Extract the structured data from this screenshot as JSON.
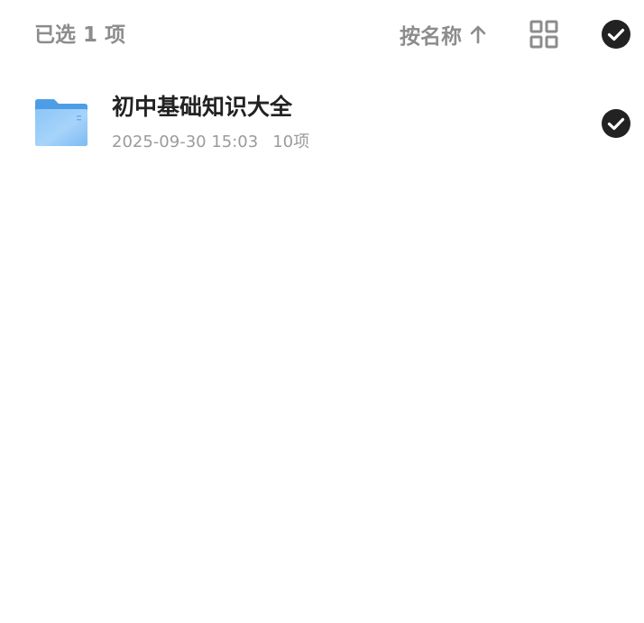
{
  "header": {
    "selected_count_label": "已选 1 项",
    "sort_label": "按名称",
    "sort_direction_icon": "arrow-up-icon",
    "view_toggle_icon": "grid-view-icon",
    "select_all_icon": "check-circle-icon"
  },
  "files": [
    {
      "name": "初中基础知识大全",
      "date": "2025-09-30 15:03",
      "count": "10项",
      "icon": "folder-icon",
      "selected": true
    }
  ],
  "colors": {
    "text_primary": "#222222",
    "text_secondary": "#9b9b9b",
    "header_text": "#8c8c8c",
    "check_fill": "#222222",
    "folder_blue": "#5aa8ee"
  }
}
